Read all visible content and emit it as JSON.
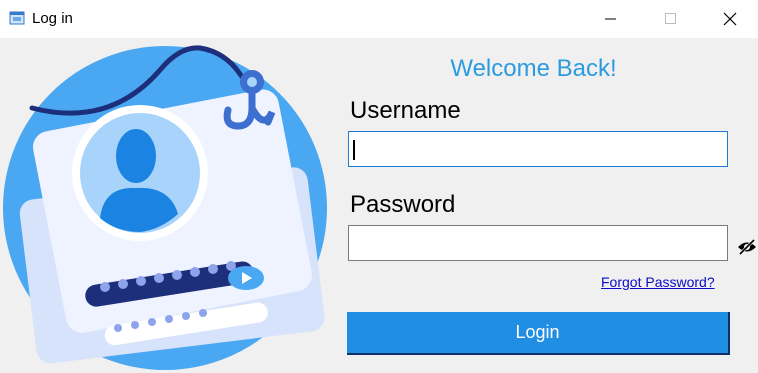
{
  "window": {
    "title": "Log in",
    "icon": "app-window-icon",
    "controls": [
      "minimize-icon",
      "maximize-icon",
      "close-icon"
    ]
  },
  "illustration": {
    "icon": "login-illustration"
  },
  "form": {
    "heading": "Welcome Back!",
    "username_label": "Username",
    "username_value": "",
    "password_label": "Password",
    "password_value": "",
    "password_toggle_icon": "eye-slash-icon",
    "forgot_link": "Forgot Password?",
    "login_button": "Login"
  },
  "colors": {
    "accent": "#2b9be0",
    "button": "#1f8ee3",
    "link": "#0a0ac8",
    "illustration_blue": "#4aa8f2",
    "illustration_navy": "#1d2f7a"
  }
}
